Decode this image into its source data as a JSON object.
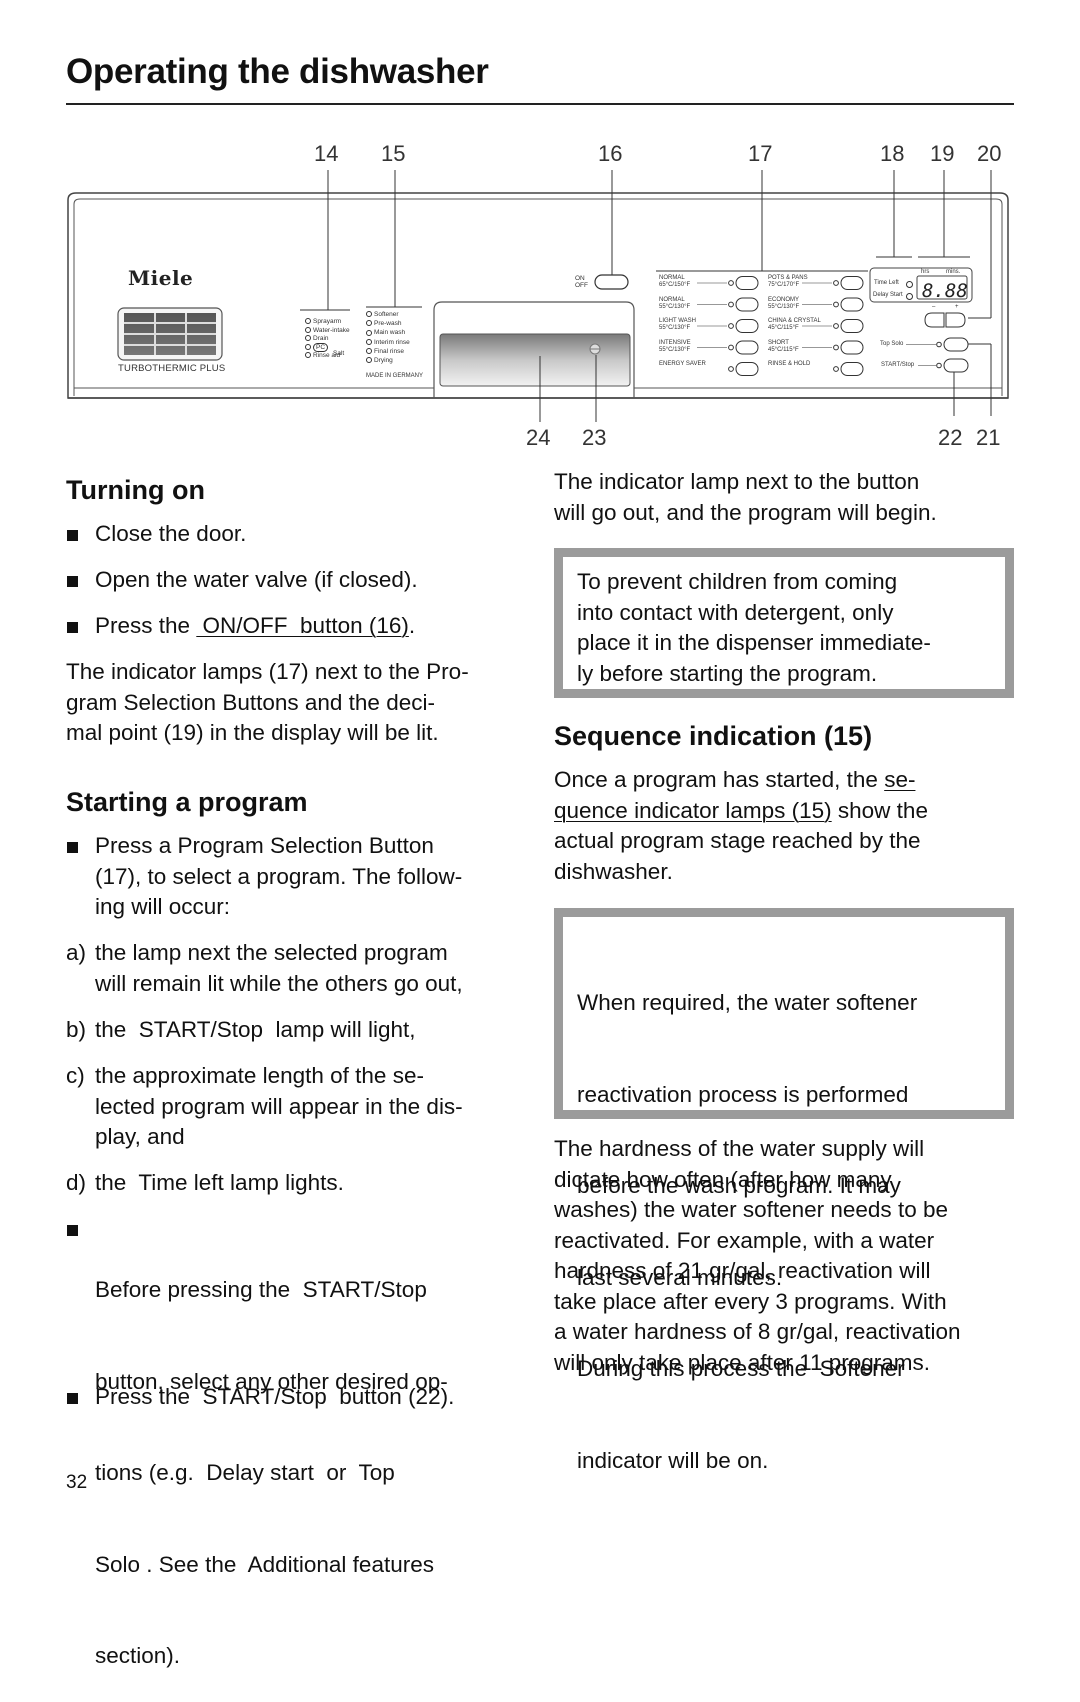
{
  "page": {
    "title": "Operating the dishwasher",
    "page_number": "32"
  },
  "diagram": {
    "callouts_top": [
      "14",
      "15",
      "16",
      "17",
      "18",
      "19",
      "20"
    ],
    "callouts_bottom": [
      "24",
      "23",
      "22",
      "21"
    ],
    "brand": "Miele",
    "model_label": "TURBOTHERMIC PLUS",
    "status_indicators": [
      "Sprayarm",
      "Water-intake",
      "Drain",
      "PC",
      "Rinse aid"
    ],
    "salt_label": "Salt",
    "sequence_indicators": [
      "Softener",
      "Pre-wash",
      "Main wash",
      "Interim rinse",
      "Final rinse",
      "Drying"
    ],
    "made_in": "MADE IN GERMANY",
    "on_label": "ON",
    "off_label": "OFF",
    "programs_left": [
      {
        "name": "NORMAL",
        "temp": "65°C/150°F"
      },
      {
        "name": "NORMAL",
        "temp": "55°C/130°F"
      },
      {
        "name": "LIGHT WASH",
        "temp": "55°C/130°F"
      },
      {
        "name": "INTENSIVE",
        "temp": "55°C/130°F"
      },
      {
        "name": "ENERGY SAVER",
        "temp": ""
      }
    ],
    "programs_right": [
      {
        "name": "POTS & PANS",
        "temp": "75°C/170°F"
      },
      {
        "name": "ECONOMY",
        "temp": "55°C/130°F"
      },
      {
        "name": "CHINA & CRYSTAL",
        "temp": "45°C/115°F"
      },
      {
        "name": "SHORT",
        "temp": "45°C/115°F"
      },
      {
        "name": "RINSE & HOLD",
        "temp": ""
      }
    ],
    "display": {
      "hrs_label": "hrs",
      "mins_label": "mins.",
      "time_left_label": "Time Left",
      "delay_start_label": "Delay Start",
      "value": "8.88",
      "minus": "–",
      "plus": "+"
    },
    "top_solo_label": "Top Solo",
    "start_stop_label": "START/Stop"
  },
  "left": {
    "turning_on": {
      "heading": "Turning on",
      "bullets": [
        "Close the door.",
        "Open the water valve (if closed)."
      ],
      "bullet3_prefix": "Press the ",
      "bullet3_link": " ON/OFF  button (16)",
      "bullet3_suffix": ".",
      "para": [
        "The indicator lamps (17) next to the Pro-",
        "gram Selection Buttons and the deci-",
        "mal point (19) in the display will be lit."
      ]
    },
    "starting": {
      "heading": "Starting a program",
      "bullet1": [
        "Press a Program Selection Button",
        "(17), to select a program. The follow-",
        "ing will occur:"
      ],
      "a": {
        "label": "a)",
        "lines": [
          "the lamp next the selected program",
          "will remain lit while the others go out,"
        ]
      },
      "b": {
        "label": "b)",
        "lines": [
          "the  START/Stop  lamp will light,"
        ]
      },
      "c": {
        "label": "c)",
        "lines": [
          "the approximate length of the se-",
          "lected program will appear in the dis-",
          "play, and"
        ]
      },
      "d": {
        "label": "d)",
        "lines": [
          "the  Time left lamp lights."
        ]
      },
      "bullet2": [
        "Before pressing the  START/Stop",
        "button, select any other desired op-",
        "tions (e.g.  Delay start  or  Top",
        "Solo . See the  Additional features",
        "section)."
      ],
      "bullet3": [
        "Press the  START/Stop  button (22)."
      ]
    }
  },
  "right": {
    "intro": [
      "The indicator lamp next to the button",
      "will go out, and the program will begin."
    ],
    "note1": [
      "To prevent children from coming",
      "into contact with detergent, only",
      "place it in the dispenser immediate-",
      "ly before starting the program."
    ],
    "sequence": {
      "heading": "Sequence indication (15)",
      "line1_prefix": "Once a program has started, the ",
      "line1_link": "se-",
      "line2_link": "quence indicator lamps (15)",
      "line2_suffix": " show the",
      "rest": [
        "actual program stage reached by the",
        "dishwasher."
      ]
    },
    "note2": [
      "When required, the water softener",
      "reactivation process is performed",
      "before the wash program. It may",
      "last several minutes.",
      "During this process the  Softener",
      "indicator will be on."
    ],
    "hardness": [
      "The hardness of the water supply will",
      "dictate how often (after how many",
      "washes) the water softener needs to be",
      "reactivated. For example, with a water",
      "hardness of 21 gr/gal, reactivation will",
      "take place after every 3 programs. With",
      "a water hardness of 8 gr/gal, reactivation",
      "will only take place after 11 programs."
    ]
  }
}
